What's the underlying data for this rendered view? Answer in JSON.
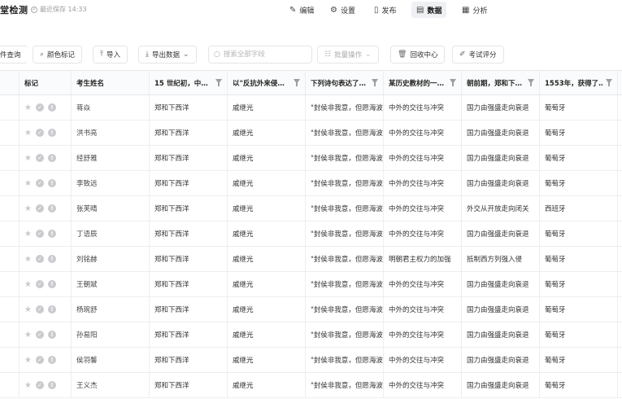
{
  "topbar": {
    "title": "堂检测",
    "save_status": "最近保存 14:33",
    "nav": [
      {
        "label": "编辑",
        "icon": "edit-icon"
      },
      {
        "label": "设置",
        "icon": "gear-icon"
      },
      {
        "label": "发布",
        "icon": "publish-icon"
      },
      {
        "label": "数据",
        "icon": "data-icon",
        "active": true
      },
      {
        "label": "分析",
        "icon": "analysis-icon"
      }
    ]
  },
  "toolbar": {
    "condition_query": "件查询",
    "color_mark": "颜色标记",
    "import": "导入",
    "export": "导出数据",
    "search_placeholder": "搜索全部字段",
    "batch": "批量操作",
    "recycle": "回收中心",
    "grading": "考试评分"
  },
  "table": {
    "columns": [
      "",
      "标记",
      "考生姓名",
      "15 世纪初，中…",
      "以\"反抗外来侵…",
      "下列诗句表达了…",
      "某历史教材的一…",
      "朝前期，郑和下…",
      "1553年，获得了…"
    ],
    "rows": [
      {
        "name": "蒋焱",
        "q1": "郑和下西洋",
        "q2": "戚继光",
        "q3": "\"封侯非我意，但愿海波",
        "q4": "中外的交往与冲突",
        "q5": "国力由强盛走向衰退",
        "q6": "葡萄牙"
      },
      {
        "name": "洪书亮",
        "q1": "郑和下西洋",
        "q2": "戚继光",
        "q3": "\"封侯非我意，但愿海波",
        "q4": "中外的交往与冲突",
        "q5": "国力由强盛走向衰退",
        "q6": "葡萄牙"
      },
      {
        "name": "经舒雅",
        "q1": "郑和下西洋",
        "q2": "戚继光",
        "q3": "\"封侯非我意，但愿海波",
        "q4": "中外的交往与冲突",
        "q5": "国力由强盛走向衰退",
        "q6": "葡萄牙"
      },
      {
        "name": "李致远",
        "q1": "郑和下西洋",
        "q2": "戚继光",
        "q3": "\"封侯非我意，但愿海波",
        "q4": "中外的交往与冲突",
        "q5": "国力由强盛走向衰退",
        "q6": "葡萄牙"
      },
      {
        "name": "张芙晴",
        "q1": "郑和下西洋",
        "q2": "戚继光",
        "q3": "\"封侯非我意，但愿海波",
        "q4": "中外的交往与冲突",
        "q5": "外交从开放走向闭关",
        "q6": "西班牙"
      },
      {
        "name": "丁语辰",
        "q1": "郑和下西洋",
        "q2": "戚继光",
        "q3": "\"封侯非我意，但愿海波",
        "q4": "中外的交往与冲突",
        "q5": "国力由强盛走向衰退",
        "q6": "葡萄牙"
      },
      {
        "name": "刘铭赫",
        "q1": "郑和下西洋",
        "q2": "戚继光",
        "q3": "\"封侯非我意，但愿海波",
        "q4": "明朝君主权力的加强",
        "q5": "抵制西方列强入侵",
        "q6": "葡萄牙"
      },
      {
        "name": "王朝斌",
        "q1": "郑和下西洋",
        "q2": "戚继光",
        "q3": "\"封侯非我意，但愿海波",
        "q4": "中外的交往与冲突",
        "q5": "国力由强盛走向衰退",
        "q6": "葡萄牙"
      },
      {
        "name": "杨琬舒",
        "q1": "郑和下西洋",
        "q2": "戚继光",
        "q3": "\"封侯非我意，但愿海波",
        "q4": "中外的交往与冲突",
        "q5": "国力由强盛走向衰退",
        "q6": "葡萄牙"
      },
      {
        "name": "孙易阳",
        "q1": "郑和下西洋",
        "q2": "戚继光",
        "q3": "\"封侯非我意，但愿海波",
        "q4": "中外的交往与冲突",
        "q5": "国力由强盛走向衰退",
        "q6": "葡萄牙"
      },
      {
        "name": "侯羽馨",
        "q1": "郑和下西洋",
        "q2": "戚继光",
        "q3": "\"封侯非我意，但愿海波",
        "q4": "中外的交往与冲突",
        "q5": "国力由强盛走向衰退",
        "q6": "葡萄牙"
      },
      {
        "name": "王义杰",
        "q1": "郑和下西洋",
        "q2": "戚继光",
        "q3": "\"封侯非我意，但愿海波",
        "q4": "中外的交往与冲突",
        "q5": "国力由强盛走向衰退",
        "q6": "葡萄牙"
      }
    ]
  }
}
